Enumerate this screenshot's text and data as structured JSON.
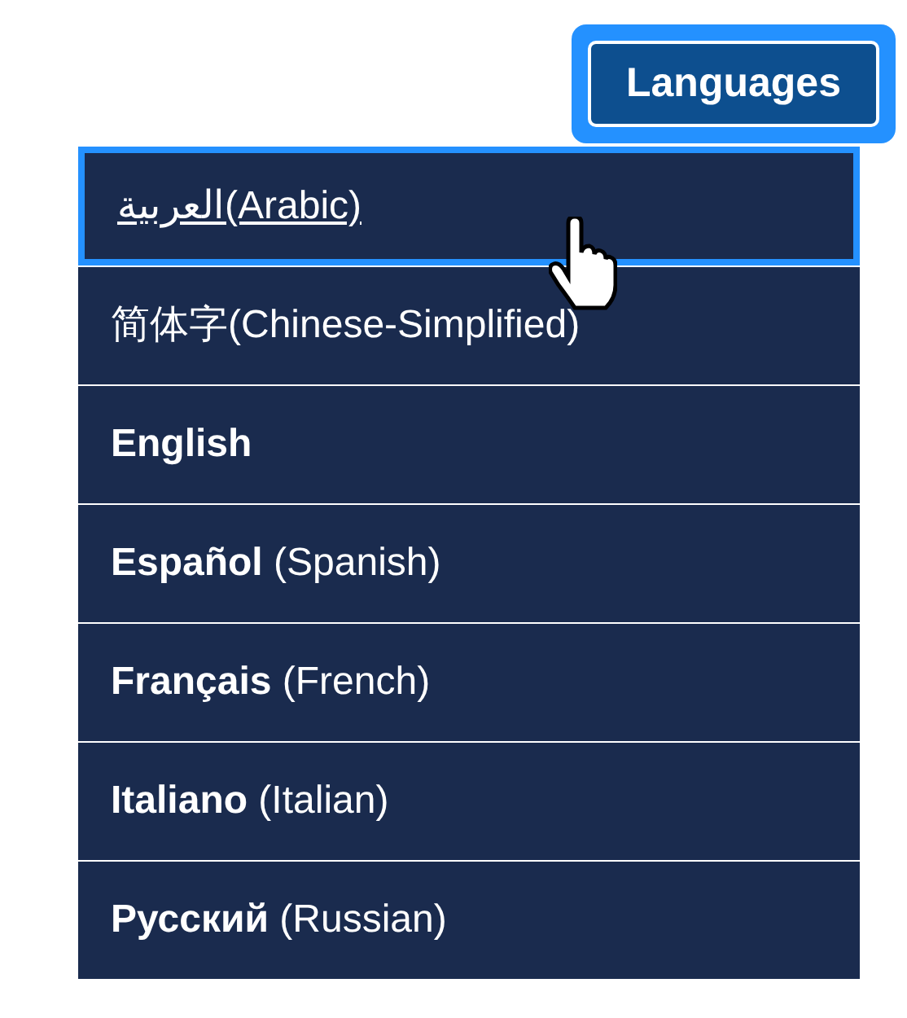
{
  "languages_button": {
    "label": "Languages",
    "focused": true
  },
  "menu": {
    "items": [
      {
        "label": "العربية(Arabic)",
        "focused": true
      },
      {
        "label": "简体字(Chinese-Simplified)",
        "focused": false
      },
      {
        "label": "**English**",
        "focused": false
      },
      {
        "label": "**Español** (Spanish)",
        "focused": false
      },
      {
        "label": "**Français** (French)",
        "focused": false
      },
      {
        "label": "**Italiano** (Italian)",
        "focused": false
      },
      {
        "label": "**Русский** (Russian)",
        "focused": false
      }
    ]
  }
}
